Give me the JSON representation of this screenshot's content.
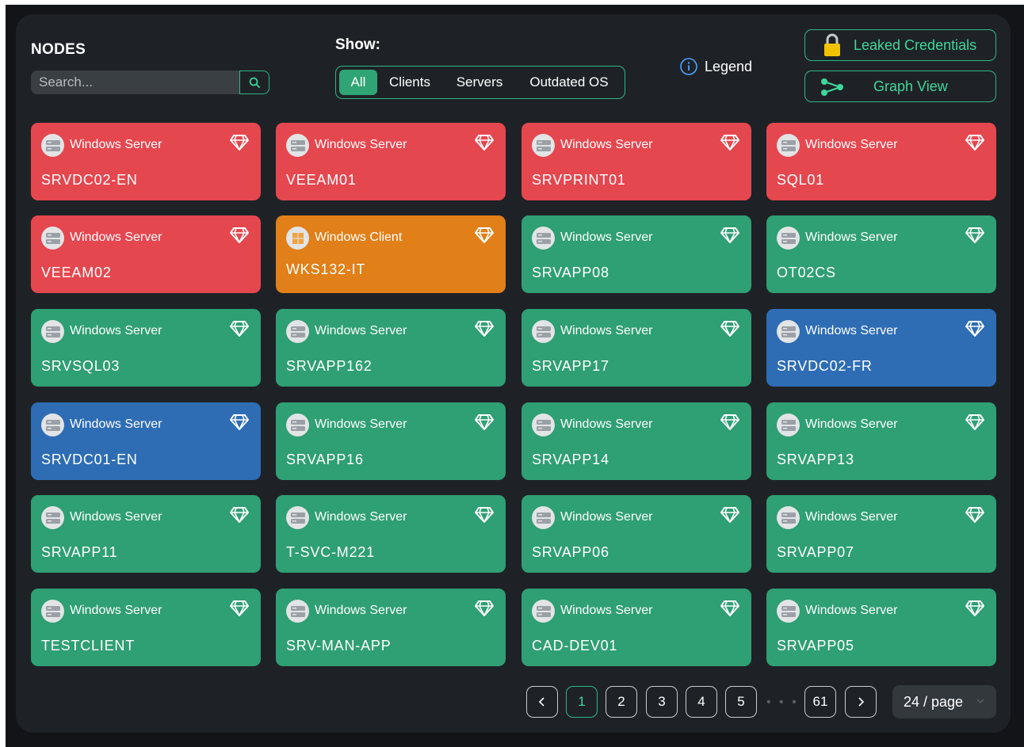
{
  "header": {
    "title": "NODES",
    "search_placeholder": "Search...",
    "show_label": "Show:",
    "filters": [
      "All",
      "Clients",
      "Servers",
      "Outdated OS"
    ],
    "active_filter": "All",
    "legend_label": "Legend",
    "leaked_credentials_label": "Leaked Credentials",
    "graph_view_label": "Graph View"
  },
  "colors": {
    "red": "#e5474f",
    "orange": "#e17f18",
    "green": "#2f9f74",
    "blue": "#2e6db4",
    "accent": "#2fb585"
  },
  "nodes": [
    {
      "os": "Windows Server",
      "name": "SRVDC02-EN",
      "status": "red"
    },
    {
      "os": "Windows Server",
      "name": "VEEAM01",
      "status": "red"
    },
    {
      "os": "Windows Server",
      "name": "SRVPRINT01",
      "status": "red"
    },
    {
      "os": "Windows Server",
      "name": "SQL01",
      "status": "red"
    },
    {
      "os": "Windows Server",
      "name": "VEEAM02",
      "status": "red"
    },
    {
      "os": "Windows Client",
      "name": "WKS132-IT",
      "status": "orange"
    },
    {
      "os": "Windows Server",
      "name": "SRVAPP08",
      "status": "green"
    },
    {
      "os": "Windows Server",
      "name": "OT02CS",
      "status": "green"
    },
    {
      "os": "Windows Server",
      "name": "SRVSQL03",
      "status": "green"
    },
    {
      "os": "Windows Server",
      "name": "SRVAPP162",
      "status": "green"
    },
    {
      "os": "Windows Server",
      "name": "SRVAPP17",
      "status": "green"
    },
    {
      "os": "Windows Server",
      "name": "SRVDC02-FR",
      "status": "blue"
    },
    {
      "os": "Windows Server",
      "name": "SRVDC01-EN",
      "status": "blue"
    },
    {
      "os": "Windows Server",
      "name": "SRVAPP16",
      "status": "green"
    },
    {
      "os": "Windows Server",
      "name": "SRVAPP14",
      "status": "green"
    },
    {
      "os": "Windows Server",
      "name": "SRVAPP13",
      "status": "green"
    },
    {
      "os": "Windows Server",
      "name": "SRVAPP11",
      "status": "green"
    },
    {
      "os": "Windows Server",
      "name": "T-SVC-M221",
      "status": "green"
    },
    {
      "os": "Windows Server",
      "name": "SRVAPP06",
      "status": "green"
    },
    {
      "os": "Windows Server",
      "name": "SRVAPP07",
      "status": "green"
    },
    {
      "os": "Windows Server",
      "name": "TESTCLIENT",
      "status": "green"
    },
    {
      "os": "Windows Server",
      "name": "SRV-MAN-APP",
      "status": "green"
    },
    {
      "os": "Windows Server",
      "name": "CAD-DEV01",
      "status": "green"
    },
    {
      "os": "Windows Server",
      "name": "SRVAPP05",
      "status": "green"
    }
  ],
  "pagination": {
    "pages": [
      "1",
      "2",
      "3",
      "4",
      "5"
    ],
    "current": "1",
    "ellipsis": "• • •",
    "last": "61",
    "page_size": "24 / page"
  }
}
